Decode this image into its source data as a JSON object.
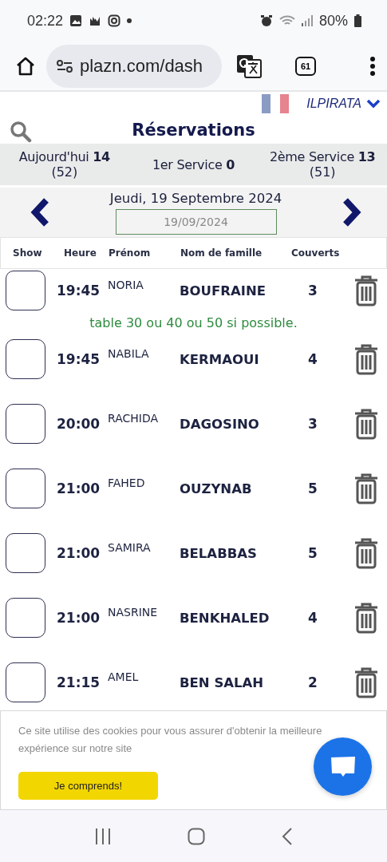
{
  "status_bar": {
    "time": "02:22",
    "battery": "80%"
  },
  "browser": {
    "url": "plazn.com/dash",
    "tab_count": "61"
  },
  "header": {
    "account": "ILPIRATA",
    "title": "Réservations"
  },
  "stats": [
    {
      "label": "Aujourd'hui",
      "value": "14",
      "sub": "(52)"
    },
    {
      "label": "1er Service",
      "value": "0"
    },
    {
      "label": "2ème Service",
      "value": "13",
      "sub": "(51)"
    }
  ],
  "date_nav": {
    "date_label": "Jeudi, 19 Septembre 2024",
    "date_value": "19/09/2024"
  },
  "table": {
    "columns": [
      "Show",
      "Heure",
      "Prénom",
      "Nom de famille",
      "Couverts"
    ],
    "rows": [
      {
        "checked": false,
        "time": "19:45",
        "first_name": "NORIA",
        "last_name": "BOUFRAINE",
        "covers": "3",
        "note": "table 30 ou 40 ou 50 si possible."
      },
      {
        "checked": false,
        "time": "19:45",
        "first_name": "NABILA",
        "last_name": "KERMAOUI",
        "covers": "4"
      },
      {
        "checked": false,
        "time": "20:00",
        "first_name": "RACHIDA",
        "last_name": "DAGOSINO",
        "covers": "3"
      },
      {
        "checked": false,
        "time": "21:00",
        "first_name": "FAHED",
        "last_name": "OUZYNAB",
        "covers": "5"
      },
      {
        "checked": false,
        "time": "21:00",
        "first_name": "SAMIRA",
        "last_name": "BELABBAS",
        "covers": "5"
      },
      {
        "checked": false,
        "time": "21:00",
        "first_name": "NASRINE",
        "last_name": "BENKHALED",
        "covers": "4"
      },
      {
        "checked": false,
        "time": "21:15",
        "first_name": "AMEL",
        "last_name": "BEN SALAH",
        "covers": "2"
      }
    ]
  },
  "cookie_banner": {
    "text": "Ce site utilise des cookies pour vous assurer d'obtenir la meilleure expérience sur notre site",
    "button": "Je comprends!"
  }
}
